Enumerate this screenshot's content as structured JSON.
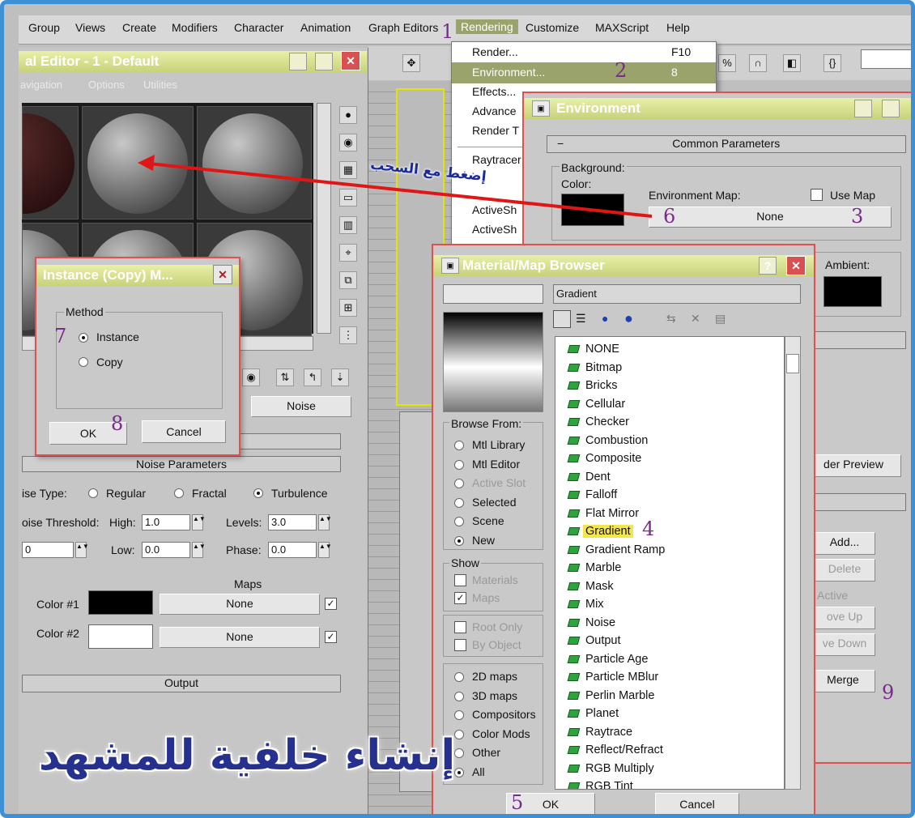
{
  "menubar": {
    "items": [
      "Group",
      "Views",
      "Create",
      "Modifiers",
      "Character",
      "Animation",
      "Graph Editors",
      "Rendering",
      "Customize",
      "MAXScript",
      "Help"
    ]
  },
  "rendering_menu": {
    "items": [
      {
        "label": "Render...",
        "shortcut": "F10"
      },
      {
        "label": "Environment...",
        "shortcut": "8"
      },
      {
        "label": "Effects..."
      },
      {
        "label": "Advance"
      },
      {
        "label": "Render T"
      },
      {
        "label": "Raytracer"
      },
      {
        "label": "ActiveSh"
      },
      {
        "label": "ActiveSh"
      }
    ]
  },
  "material_editor": {
    "title": "al Editor - 1 - Default",
    "menu": [
      "avigation",
      "Options",
      "Utilities"
    ],
    "noise_button": "Noise",
    "rollouts": {
      "noise_params": "Noise Parameters",
      "output": "Output"
    },
    "noise_type_label": "ise Type:",
    "noise_types": [
      "Regular",
      "Fractal",
      "Turbulence"
    ],
    "threshold_label": "oise Threshold:",
    "high_label": "High:",
    "high_value": "1.0",
    "levels_label": "Levels:",
    "levels_value": "3.0",
    "low_label": "Low:",
    "low_value": "0.0",
    "phase_label": "Phase:",
    "phase_value": "0.0",
    "maps_label": "Maps",
    "color1_label": "Color #1",
    "color2_label": "Color #2",
    "map_none_1": "None",
    "map_none_2": "None",
    "left_value": "0"
  },
  "instance_dialog": {
    "title": "Instance (Copy) M...",
    "method_label": "Method",
    "options": [
      "Instance",
      "Copy"
    ],
    "selected": "Instance",
    "ok": "OK",
    "cancel": "Cancel"
  },
  "environment": {
    "title": "Environment",
    "rollout": "Common Parameters",
    "background_label": "Background:",
    "color_label": "Color:",
    "env_map_label": "Environment Map:",
    "use_map_label": "Use Map",
    "env_map_button": "None",
    "ambient_label": "Ambient:",
    "render_preview": "der Preview",
    "add": "Add...",
    "delete": "Delete",
    "active": "Active",
    "move_up": "ove Up",
    "move_down": "ve Down",
    "merge": "Merge"
  },
  "browser": {
    "title": "Material/Map Browser",
    "search_value": "Gradient",
    "browse_from_label": "Browse From:",
    "browse_from": [
      "Mtl Library",
      "Mtl Editor",
      "Active Slot",
      "Selected",
      "Scene",
      "New"
    ],
    "browse_selected": "New",
    "show_label": "Show",
    "show": [
      "Materials",
      "Maps"
    ],
    "root_only": "Root Only",
    "by_object": "By Object",
    "map_types": [
      "2D maps",
      "3D maps",
      "Compositors",
      "Color Mods",
      "Other",
      "All"
    ],
    "map_list": [
      "NONE",
      "Bitmap",
      "Bricks",
      "Cellular",
      "Checker",
      "Combustion",
      "Composite",
      "Dent",
      "Falloff",
      "Flat Mirror",
      "Gradient",
      "Gradient Ramp",
      "Marble",
      "Mask",
      "Mix",
      "Noise",
      "Output",
      "Particle Age",
      "Particle MBlur",
      "Perlin Marble",
      "Planet",
      "Raytrace",
      "Reflect/Refract",
      "RGB Multiply",
      "RGB Tint"
    ],
    "highlighted": "Gradient",
    "ok": "OK",
    "cancel": "Cancel"
  },
  "annotations": {
    "drag_hint": "إضغط مع السحب",
    "footer_title": "إنشاء خلفية للمشهد",
    "step_numbers": [
      "1",
      "2",
      "3",
      "4",
      "5",
      "6",
      "7",
      "8",
      "9"
    ]
  },
  "colors": {
    "accent_blue": "#3d8fd6",
    "highlight_yellow": "#f4e64a",
    "arrow_red": "#e01616",
    "title_bar": "#c7d27a"
  }
}
